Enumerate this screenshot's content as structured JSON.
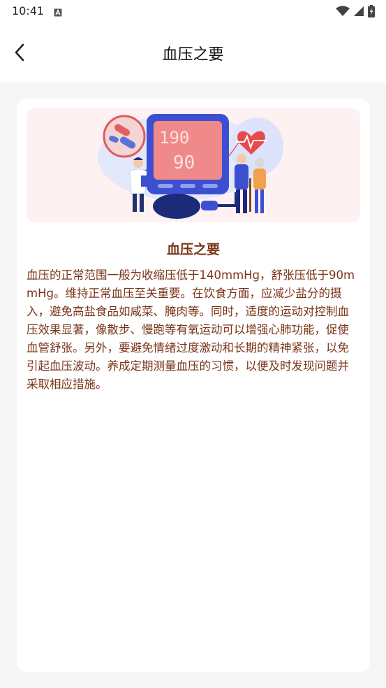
{
  "status_bar": {
    "time": "10:41"
  },
  "header": {
    "title": "血压之要"
  },
  "banner": {
    "monitor_readings": [
      "190",
      "90"
    ]
  },
  "article": {
    "title": "血压之要",
    "body": "血压的正常范围一般为收缩压低于140mmHg，舒张压低于90mmHg。维持正常血压至关重要。在饮食方面，应减少盐分的摄入，避免高盐食品如咸菜、腌肉等。同时，适度的运动对控制血压效果显著，像散步、慢跑等有氧运动可以增强心肺功能，促使血管舒张。另外，要避免情绪过度激动和长期的精神紧张，以免引起血压波动。养成定期测量血压的习惯，以便及时发现问题并采取相应措施。"
  },
  "colors": {
    "accent_text": "#7a3418",
    "banner_bg": "#fdf1f1",
    "monitor_blue": "#3d4fd1"
  }
}
